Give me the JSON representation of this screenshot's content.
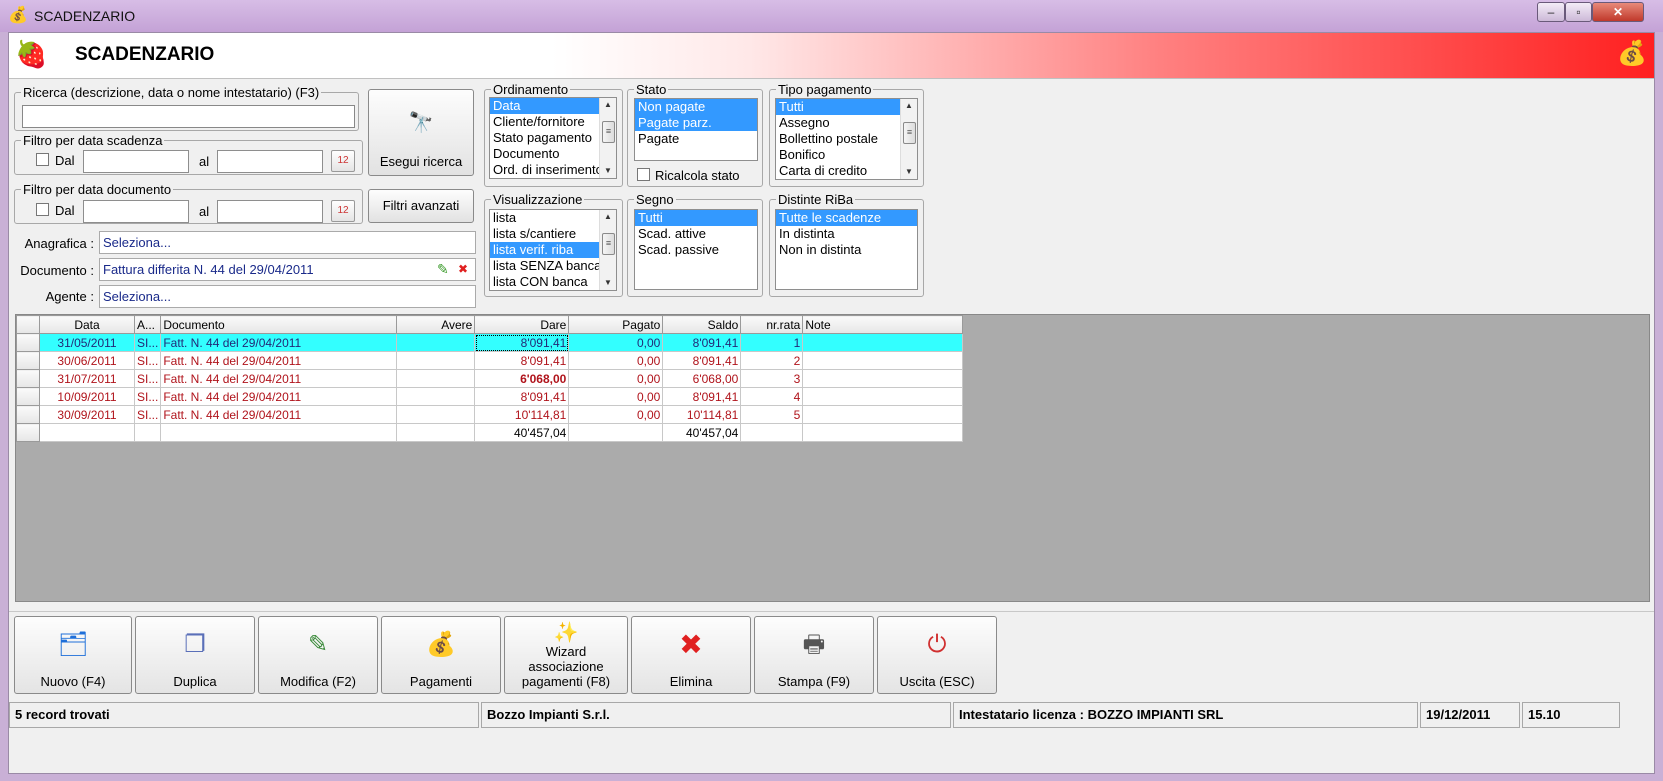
{
  "window": {
    "title": "SCADENZARIO",
    "min_icon": "minimize-icon",
    "max_icon": "maximize-icon",
    "close_icon": "close-icon",
    "min_glyph": "–",
    "max_glyph": "▫",
    "close_glyph": "✕"
  },
  "header": {
    "title": "SCADENZARIO",
    "logo_icon": "strawberry-icon",
    "logo_glyph": "🍓",
    "right_icon": "money-bag-icon",
    "right_glyph": "💰"
  },
  "search": {
    "label": "Ricerca (descrizione, data o nome intestatario) (F3)",
    "value": "",
    "run_button": "Esegui ricerca",
    "binoculars_glyph": "🔭",
    "advanced_button": "Filtri avanzati"
  },
  "filter_due": {
    "label": "Filtro per data scadenza",
    "from_label": "Dal",
    "to_label": "al",
    "from_value": "",
    "to_value": "",
    "cal_glyph": "12"
  },
  "filter_doc": {
    "label": "Filtro per data documento",
    "from_label": "Dal",
    "to_label": "al",
    "from_value": "",
    "to_value": "",
    "cal_glyph": "12"
  },
  "fields": {
    "anagrafica_label": "Anagrafica :",
    "anagrafica_value": "Seleziona...",
    "documento_label": "Documento :",
    "documento_value": "Fattura differita N. 44 del 29/04/2011",
    "edit_glyph": "✎",
    "clear_glyph": "✖",
    "agente_label": "Agente :",
    "agente_value": "Seleziona..."
  },
  "ordinamento": {
    "label": "Ordinamento",
    "items": [
      "Data",
      "Cliente/fornitore",
      "Stato pagamento",
      "Documento",
      "Ord. di inserimento"
    ]
  },
  "stato": {
    "label": "Stato",
    "items": [
      "Non pagate",
      "Pagate parz.",
      "Pagate"
    ],
    "recalc_label": "Ricalcola stato"
  },
  "tipo_pagamento": {
    "label": "Tipo pagamento",
    "items": [
      "Tutti",
      "Assegno",
      "Bollettino postale",
      "Bonifico",
      "Carta di credito"
    ]
  },
  "visualizzazione": {
    "label": "Visualizzazione",
    "items": [
      "lista",
      "lista s/cantiere",
      "lista verif. riba",
      "lista SENZA banca",
      "lista CON banca"
    ]
  },
  "segno": {
    "label": "Segno",
    "items": [
      "Tutti",
      "Scad. attive",
      "Scad. passive"
    ]
  },
  "distinte": {
    "label": "Distinte RiBa",
    "items": [
      "Tutte le scadenze",
      "In distinta",
      "Non in distinta"
    ]
  },
  "scroll": {
    "up": "▲",
    "down": "▼",
    "thumb": "≡"
  },
  "grid": {
    "columns": [
      "Data",
      "A...",
      "Documento",
      "Avere",
      "Dare",
      "Pagato",
      "Saldo",
      "nr.rata",
      "Note"
    ],
    "rows": [
      [
        "31/05/2011",
        "SI...",
        "Fatt. N. 44 del 29/04/2011",
        "",
        "8'091,41",
        "0,00",
        "8'091,41",
        "1",
        ""
      ],
      [
        "30/06/2011",
        "SI...",
        "Fatt. N. 44 del 29/04/2011",
        "",
        "8'091,41",
        "0,00",
        "8'091,41",
        "2",
        ""
      ],
      [
        "31/07/2011",
        "SI...",
        "Fatt. N. 44 del 29/04/2011",
        "",
        "6'068,00",
        "0,00",
        "6'068,00",
        "3",
        ""
      ],
      [
        "10/09/2011",
        "SI...",
        "Fatt. N. 44 del 29/04/2011",
        "",
        "8'091,41",
        "0,00",
        "8'091,41",
        "4",
        ""
      ],
      [
        "30/09/2011",
        "SI...",
        "Fatt. N. 44 del 29/04/2011",
        "",
        "10'114,81",
        "0,00",
        "10'114,81",
        "5",
        ""
      ]
    ],
    "totals": [
      "",
      "",
      "",
      "",
      "40'457,04",
      "",
      "40'457,04",
      "",
      ""
    ]
  },
  "toolbar": [
    {
      "label": "Nuovo (F4)",
      "icon": "new-record-icon",
      "glyph": "🗂",
      "color": "#1e6fd9"
    },
    {
      "label": "Duplica",
      "icon": "duplicate-icon",
      "glyph": "❐",
      "color": "#5a6fb8"
    },
    {
      "label": "Modifica (F2)",
      "icon": "edit-icon",
      "glyph": "✎",
      "color": "#3a8a3a"
    },
    {
      "label": "Pagamenti",
      "icon": "money-bag-icon",
      "glyph": "💰",
      "color": "#8a6a20"
    },
    {
      "label": "Wizard associazione pagamenti (F8)",
      "icon": "magic-wand-icon",
      "glyph": "✨",
      "color": "#222"
    },
    {
      "label": "Elimina",
      "icon": "delete-icon",
      "glyph": "✖",
      "color": "#e02020"
    },
    {
      "label": "Stampa (F9)",
      "icon": "printer-icon",
      "glyph": "🖶",
      "color": "#555"
    },
    {
      "label": "Uscita (ESC)",
      "icon": "exit-icon",
      "glyph": "⏻",
      "color": "#d03030"
    }
  ],
  "status": {
    "records": "5 record trovati",
    "company": "Bozzo Impianti S.r.l.",
    "license": "Intestatario licenza : BOZZO IMPIANTI SRL",
    "date": "19/12/2011",
    "time": "15.10"
  }
}
